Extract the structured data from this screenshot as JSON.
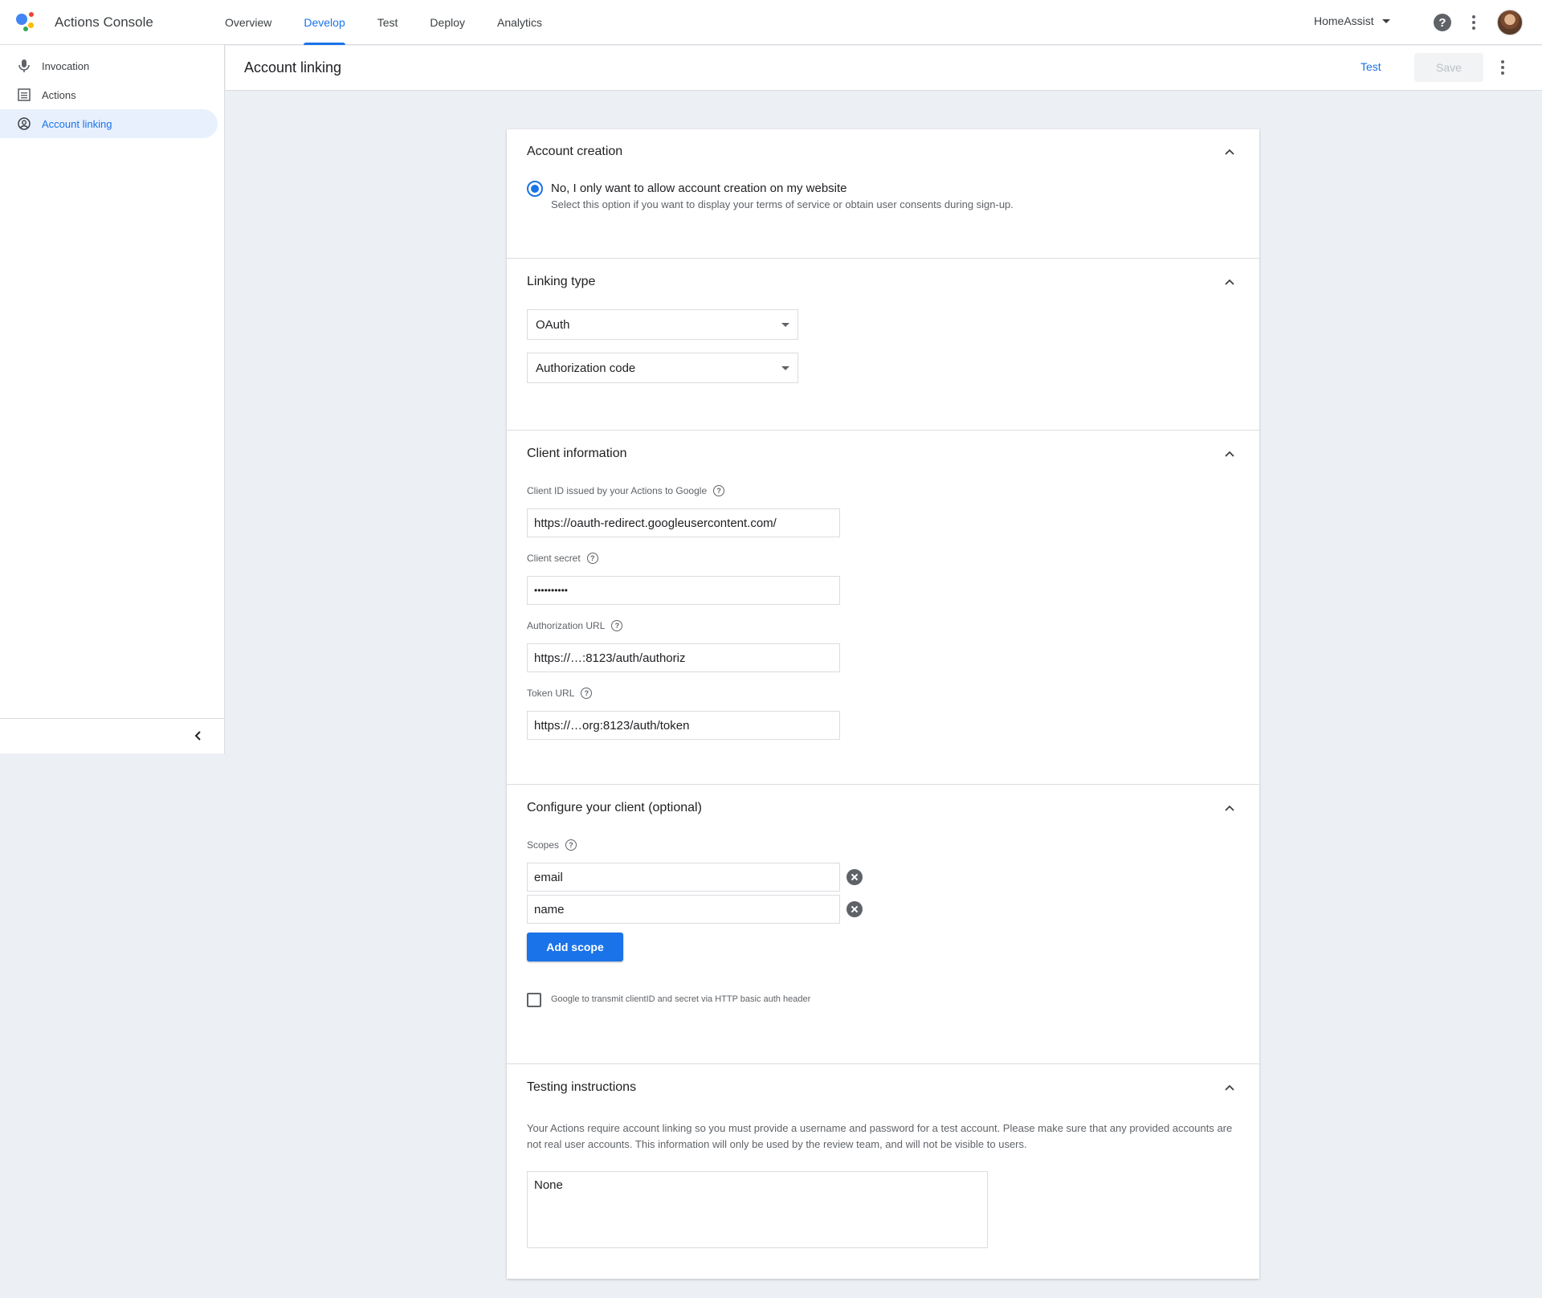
{
  "app": {
    "title": "Actions Console"
  },
  "nav": {
    "items": [
      "Overview",
      "Develop",
      "Test",
      "Deploy",
      "Analytics"
    ],
    "active": "Develop"
  },
  "project": {
    "name": "HomeAssist"
  },
  "sidebar": {
    "items": [
      {
        "label": "Invocation",
        "icon": "microphone-icon"
      },
      {
        "label": "Actions",
        "icon": "list-icon"
      },
      {
        "label": "Account linking",
        "icon": "account-circle-icon"
      }
    ]
  },
  "header": {
    "title": "Account linking",
    "test_label": "Test",
    "save_label": "Save"
  },
  "account_creation": {
    "title": "Account creation",
    "option_label": "No, I only want to allow account creation on my website",
    "option_desc": "Select this option if you want to display your terms of service or obtain user consents during sign-up."
  },
  "linking_type": {
    "title": "Linking type",
    "type_value": "OAuth",
    "grant_value": "Authorization code"
  },
  "client_info": {
    "title": "Client information",
    "client_id_label": "Client ID issued by your Actions to Google",
    "client_id_value": "https://oauth-redirect.googleusercontent.com/",
    "secret_label": "Client secret",
    "secret_value": "••••••••••",
    "auth_url_label": "Authorization URL",
    "auth_url_value": "https://…:8123/auth/authoriz",
    "token_url_label": "Token URL",
    "token_url_value": "https://…org:8123/auth/token"
  },
  "configure": {
    "title": "Configure your client (optional)",
    "scopes_label": "Scopes",
    "scopes": [
      "email",
      "name"
    ],
    "add_scope_label": "Add scope",
    "basic_auth_label": "Google to transmit clientID and secret via HTTP basic auth header"
  },
  "testing": {
    "title": "Testing instructions",
    "description": "Your Actions require account linking so you must provide a username and password for a test account. Please make sure that any provided accounts are not real user accounts. This information will only be used by the review team, and will not be visible to users.",
    "value": "None"
  },
  "colors": {
    "accent": "#1a73e8",
    "background": "#eceff3"
  }
}
